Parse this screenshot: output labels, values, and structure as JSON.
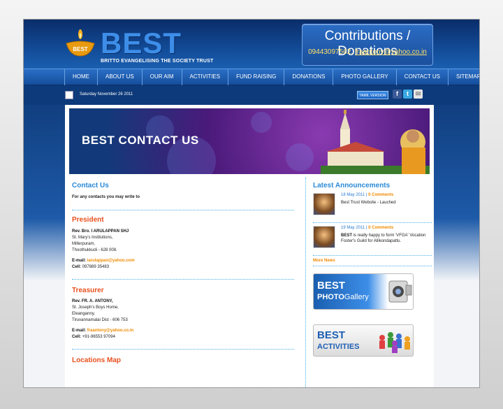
{
  "site": {
    "logo": "BEST",
    "lamp_text": "BEST",
    "tagline": "BRITTO EVANGELISING THE SOCIETY TRUST"
  },
  "donation": {
    "title": "Contributions / Donations",
    "phone": "09443097562,",
    "email": "fraantony@yahoo.co.in"
  },
  "nav": [
    "HOME",
    "ABOUT US",
    "OUR AIM",
    "ACTIVITIES",
    "FUND RAISING",
    "DONATIONS",
    "PHOTO GALLERY",
    "CONTACT US",
    "SITEMAP"
  ],
  "topbar": {
    "date": "Saturday November 26 2011",
    "tamil_label": "TAMIL VERSION"
  },
  "banner": {
    "title": "BEST CONTACT US"
  },
  "contact": {
    "title": "Contact Us",
    "intro": "For any contacts you may write to",
    "president": {
      "heading": "President",
      "name": "Rev. Bro. I ARULAPPAN SHJ",
      "line1": "St. Mary's Institutions,",
      "line2": "Millerpuram,",
      "line3": "Thoothukkudi - 628 008.",
      "email_label": "E-mail:",
      "email": "iarulappan@yahoo.com",
      "cell_label": "Cell:",
      "cell": "097889 35483"
    },
    "treasurer": {
      "heading": "Treasurer",
      "name": "Rev. FR. A. ANTONY,",
      "line1": "St. Joseph's Boys Home,",
      "line2": "Eleanganny,",
      "line3": "Tiruvannamalai Dist - 606 753",
      "email_label": "E-mail:",
      "email": "fraantony@yahoo.co.in",
      "cell_label": "Cell:",
      "cell": "+91-96553 97094"
    },
    "map_title": "Locations Map"
  },
  "announcements": {
    "title": "Latest Announcements",
    "items": [
      {
        "date": "18 May 2011",
        "comments": "0 Comments",
        "text": "Best Trust Website - Lauched"
      },
      {
        "date": "19 May 2011",
        "comments": "0 Comments",
        "text_bold": "BEST",
        "text": " is really happy to form 'VFGA' Vocation Foster's Guild for Allikondapattu."
      }
    ],
    "more": "More News"
  },
  "promos": {
    "gallery_line1": "BEST",
    "gallery_line2a": "PHOTO",
    "gallery_line2b": "Gallery",
    "activities_line1": "BEST",
    "activities_line2": "ACTIVITIES"
  },
  "colors": {
    "header_blue": "#14509e",
    "nav_blue": "#1f5fb4",
    "accent_orange": "#f08a00",
    "heading_red": "#e8501e",
    "heading_blue": "#2a8ad8"
  }
}
